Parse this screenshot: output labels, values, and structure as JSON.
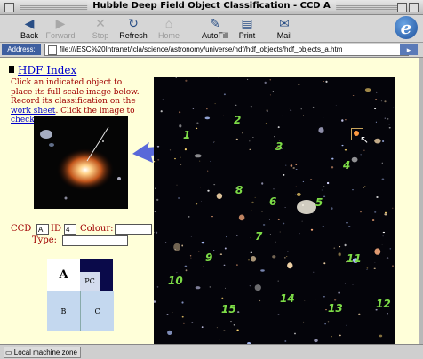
{
  "window": {
    "title": "Hubble Deep Field Object Classification - CCD A"
  },
  "toolbar": {
    "buttons": [
      {
        "label": "Back",
        "icon": "back-arrow-icon"
      },
      {
        "label": "Forward",
        "icon": "forward-arrow-icon"
      },
      {
        "label": "Stop",
        "icon": "stop-icon"
      },
      {
        "label": "Refresh",
        "icon": "refresh-icon"
      },
      {
        "label": "Home",
        "icon": "home-icon"
      },
      {
        "label": "AutoFill",
        "icon": "autofill-icon"
      },
      {
        "label": "Print",
        "icon": "print-icon"
      },
      {
        "label": "Mail",
        "icon": "mail-icon"
      }
    ],
    "logo_glyph": "e"
  },
  "address": {
    "label": "Address:",
    "url": "file:///ESC%20Intranet/icla/science/astronomy/universe/hdf/hdf_objects/hdf_objects_a.htm"
  },
  "page": {
    "hdf_index_link": "HDF Index",
    "instructions_a": "Click an indicated object to place its full scale image below. Record its classification on the ",
    "work_sheet_link": "work sheet",
    "instructions_b": ". Click the image to ",
    "check_link": "check its classification",
    "instructions_c": ".",
    "form": {
      "ccd_label": "CCD",
      "ccd_value": "A",
      "id_label": "ID",
      "id_value": "4",
      "colour_label": "Colour:",
      "colour_value": "",
      "type_label": "Type:",
      "type_value": ""
    },
    "grid": {
      "a": "A",
      "pc": "PC",
      "b": "B",
      "c": "C"
    },
    "object_labels": [
      "1",
      "2",
      "3",
      "4",
      "5",
      "6",
      "7",
      "8",
      "9",
      "10",
      "11",
      "12",
      "13",
      "14",
      "15"
    ]
  },
  "status": {
    "zone": "Local machine zone"
  },
  "colors": {
    "label_green": "#7ddc47",
    "link_blue": "#0000cc",
    "text_red": "#a00000",
    "page_bg": "#ffffd9"
  }
}
